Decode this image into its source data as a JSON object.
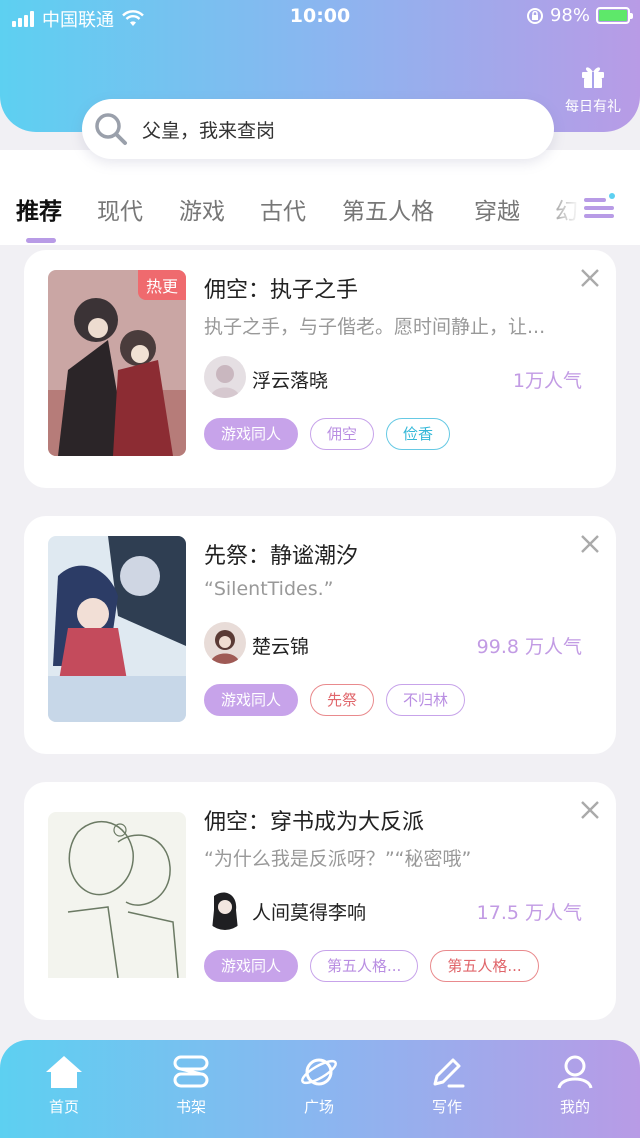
{
  "status_bar": {
    "carrier": "中国联通",
    "time": "10:00",
    "battery": "98%"
  },
  "header": {
    "gift_label": "每日有礼",
    "gift_icon": "gift-icon",
    "search_text": "父皇，我来查岗",
    "search_icon": "search-icon"
  },
  "tabs": [
    {
      "label": "推荐",
      "active": true
    },
    {
      "label": "现代"
    },
    {
      "label": "游戏"
    },
    {
      "label": "古代"
    },
    {
      "label": "第五人格"
    },
    {
      "label": "穿越"
    },
    {
      "label": "幻"
    }
  ],
  "cards": [
    {
      "badge": "热更",
      "title": "佣空：执子之手",
      "desc": "执子之手，与子偕老。愿时间静止，让...",
      "author": "浮云落晓",
      "popularity": "1万人气",
      "tags": [
        "游戏同人",
        "佣空",
        "俭香"
      ]
    },
    {
      "title": "先祭：静谧潮汐",
      "desc": "“SilentTides.”",
      "author": "楚云锦",
      "popularity": "99.8 万人气",
      "tags": [
        "游戏同人",
        "先祭",
        "不归林"
      ]
    },
    {
      "title": "佣空：穿书成为大反派",
      "desc": "“为什么我是反派呀？”“秘密哦”",
      "author": "人间莫得李响",
      "popularity": "17.5 万人气",
      "tags": [
        "游戏同人",
        "第五人格...",
        "第五人格..."
      ]
    }
  ],
  "bottom_nav": [
    {
      "label": "首页",
      "icon": "home-icon"
    },
    {
      "label": "书架",
      "icon": "bookshelf-icon"
    },
    {
      "label": "广场",
      "icon": "planet-icon"
    },
    {
      "label": "写作",
      "icon": "pen-icon"
    },
    {
      "label": "我的",
      "icon": "user-icon"
    }
  ],
  "colors": {
    "gradient_start": "#5dd0f1",
    "gradient_end": "#b89be6",
    "accent_purple": "#c7a3ea",
    "hot_red": "#ef6a6e"
  }
}
